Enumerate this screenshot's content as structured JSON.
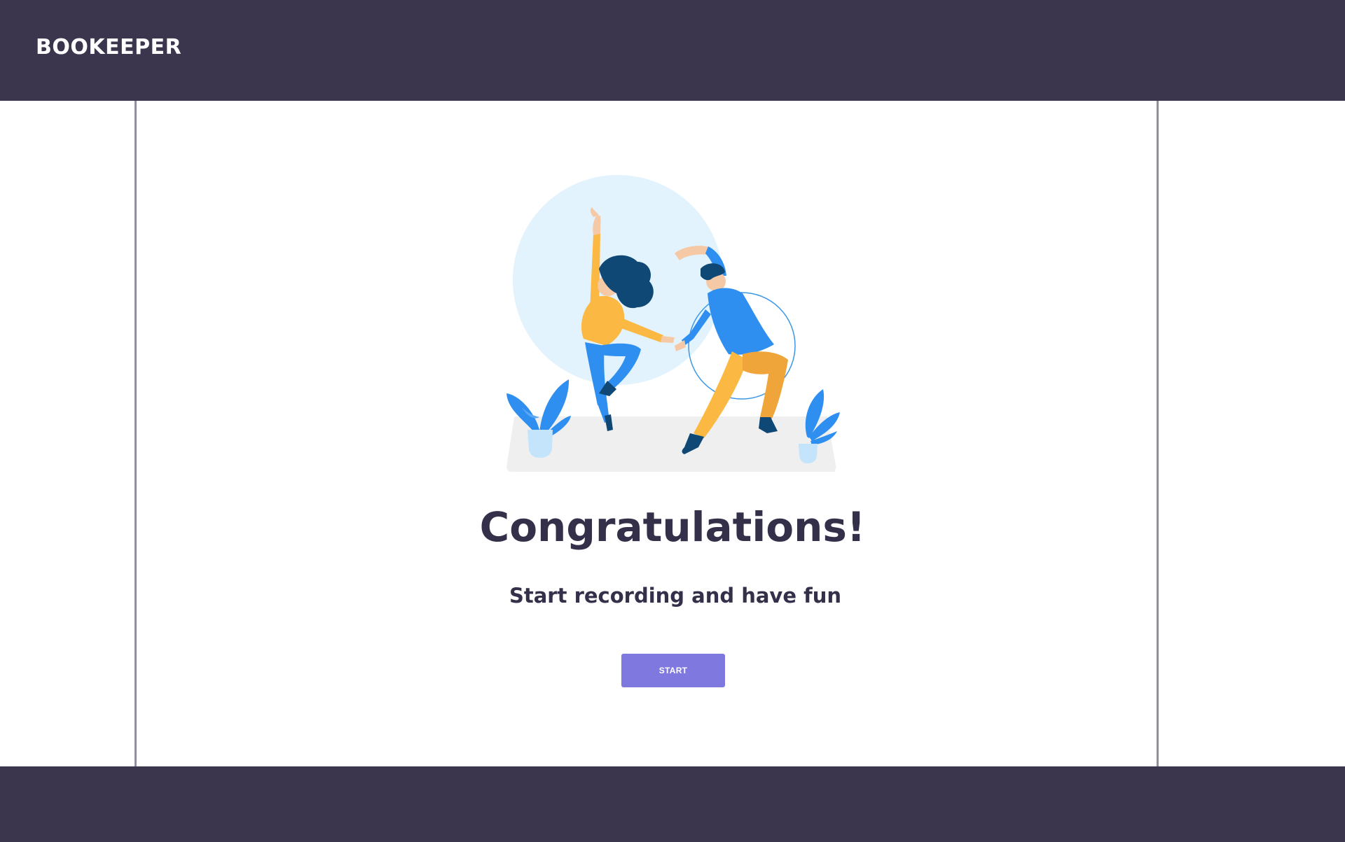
{
  "header": {
    "brand": "BOOKEEPER"
  },
  "main": {
    "illustration": "dancing-couple-illustration",
    "headline": "Congratulations!",
    "subline": "Start recording and have fun",
    "start_label": "START"
  },
  "colors": {
    "header_bg": "#3b364e",
    "footer_bg": "#3b364e",
    "text_dark": "#34304a",
    "button_bg": "#7f78de",
    "frame_border": "#8f8f9d",
    "accent_blue": "#2f8ff0",
    "accent_yellow": "#fbb944",
    "accent_navy": "#0f4775",
    "light_blue": "#e2f3fd"
  }
}
